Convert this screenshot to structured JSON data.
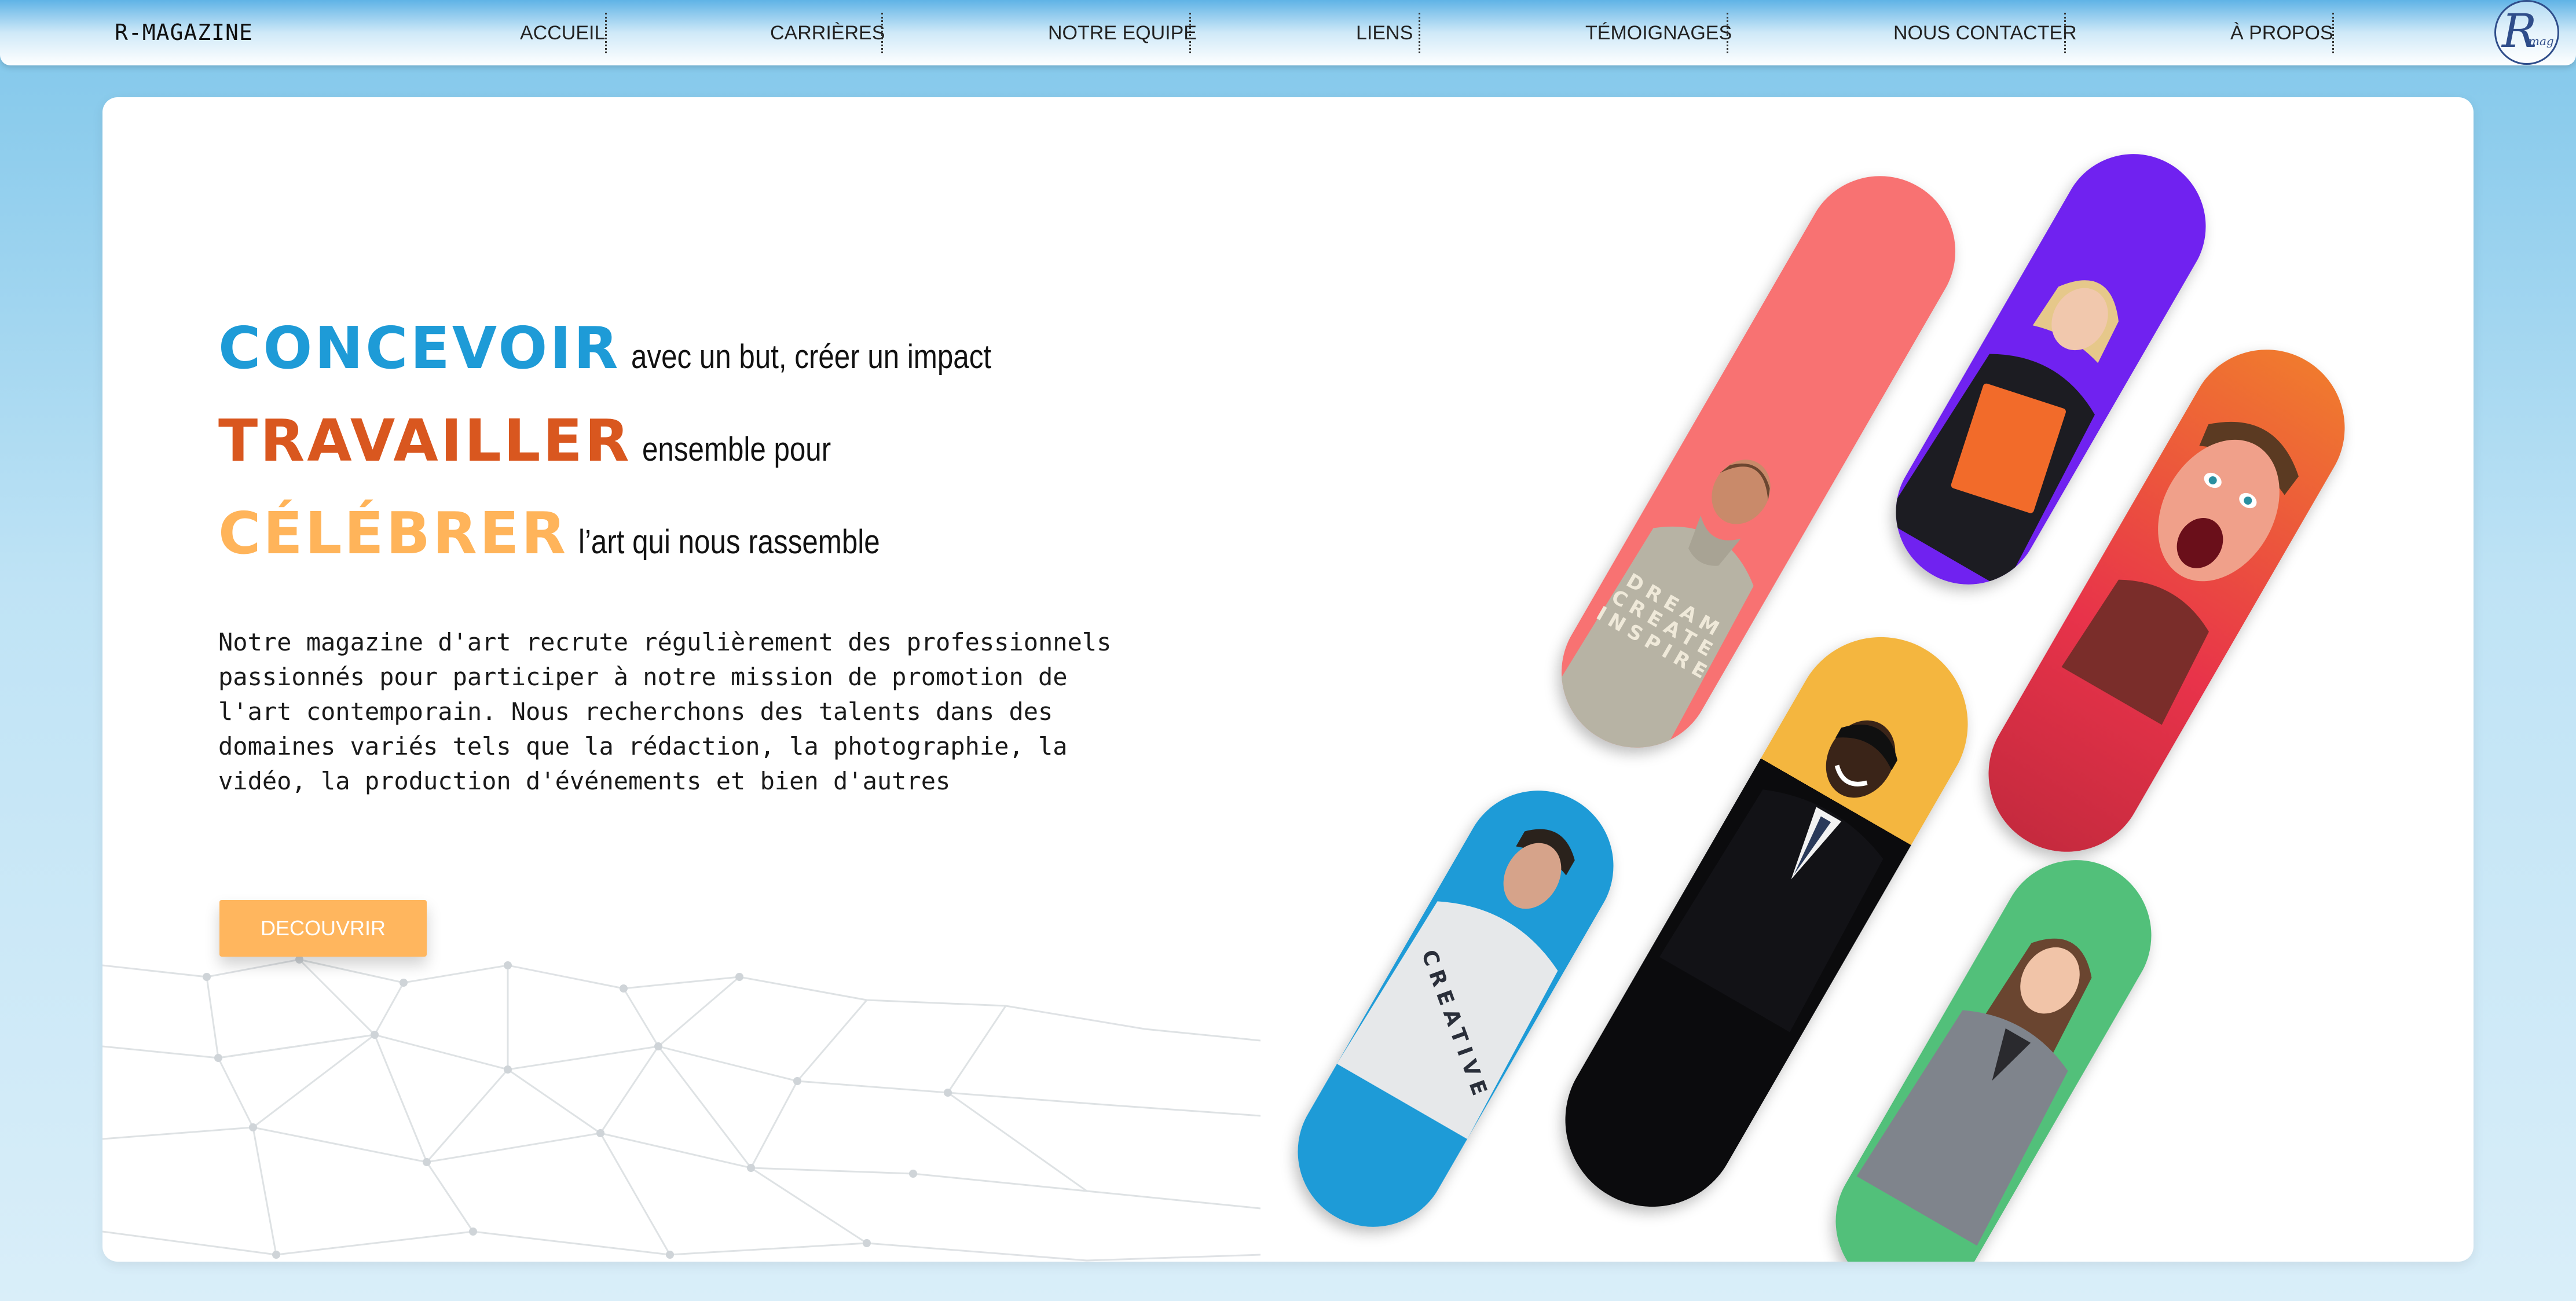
{
  "nav": {
    "brand": "R-MAGAZINE",
    "items": [
      {
        "label": "ACCUEIL"
      },
      {
        "label": "CARRIÈRES"
      },
      {
        "label": "NOTRE EQUIPE"
      },
      {
        "label": "LIENS"
      },
      {
        "label": "TÉMOIGNAGES"
      },
      {
        "label": "NOUS CONTACTER"
      },
      {
        "label": "À PROPOS"
      }
    ],
    "logo_text": "R",
    "logo_sub": "mag"
  },
  "hero": {
    "lines": [
      {
        "word": "CONCEVOIR",
        "rest": "avec un but, créer un impact",
        "color": "#1e9bd7"
      },
      {
        "word": "TRAVAILLER",
        "rest": "ensemble pour",
        "color": "#d9571f"
      },
      {
        "word": "CÉLÉBRER",
        "rest": "l’art qui nous rassemble",
        "color": "#ffb45a"
      }
    ],
    "intro": "Notre magazine d'art recrute régulièrement des professionnels passionnés pour participer à notre mission de promotion de l'art contemporain. Nous recherchons des talents dans des domaines variés tels que la rédaction, la photographie, la vidéo, la production d'événements et bien d'autres",
    "cta_label": "DECOUVRIR",
    "cta_color": "#ffb65e"
  },
  "gallery": {
    "pills": [
      {
        "name": "pill-woman-grey-hoodie",
        "color": "#f87272",
        "shirt_text": "DREAM CREATE INSPIRE"
      },
      {
        "name": "pill-woman-orange-folder",
        "color": "#7022f0",
        "shirt_text": ""
      },
      {
        "name": "pill-man-surprised",
        "color": "#f07a2e",
        "shirt_text": ""
      },
      {
        "name": "pill-man-creative-shirt",
        "color": "#1e9bd7",
        "shirt_text": "CREATIVE"
      },
      {
        "name": "pill-man-suit",
        "color": "#f4b63f",
        "shirt_text": ""
      },
      {
        "name": "pill-woman-grey-blazer",
        "color": "#52c07a",
        "shirt_text": ""
      }
    ]
  }
}
